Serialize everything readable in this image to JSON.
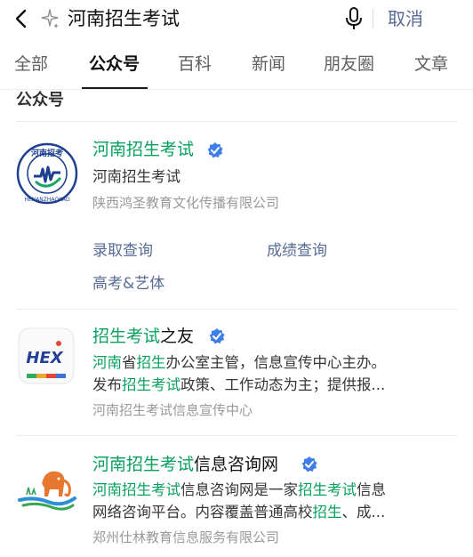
{
  "search": {
    "query": "河南招生考试",
    "cancel_label": "取消"
  },
  "tabs": [
    {
      "label": "全部",
      "active": false
    },
    {
      "label": "公众号",
      "active": true
    },
    {
      "label": "百科",
      "active": false
    },
    {
      "label": "新闻",
      "active": false
    },
    {
      "label": "朋友圈",
      "active": false
    },
    {
      "label": "文章",
      "active": false
    }
  ],
  "section_title": "公众号",
  "colors": {
    "highlight": "#07a05c",
    "link": "#576b95",
    "verified": "#3f7ee8"
  },
  "results": [
    {
      "name_highlight": "河南招生考试",
      "name_rest": "",
      "verified": true,
      "avatar_icon": "henan-zhaokao-logo",
      "avatar_text_top": "河南招考",
      "avatar_text_ring": "HENANZHAOKAO",
      "description": "河南招生考试",
      "org": "陕西鸿圣教育文化传播有限公司",
      "menu": [
        "录取查询",
        "成绩查询",
        "高考&艺体"
      ]
    },
    {
      "name_highlight": "招生考试",
      "name_rest": "之友",
      "verified": true,
      "avatar_icon": "hex-logo",
      "avatar_text": "HEX",
      "description_lines": [
        [
          {
            "t": "河南",
            "h": true
          },
          {
            "t": "省",
            "h": false
          },
          {
            "t": "招生",
            "h": true
          },
          {
            "t": "办公室主管，信息宣传中心主办。",
            "h": false
          }
        ],
        [
          {
            "t": "发布",
            "h": false
          },
          {
            "t": "招生考试",
            "h": true
          },
          {
            "t": "政策、工作动态为主；提供报...",
            "h": false
          }
        ]
      ],
      "org": "河南招生考试信息宣传中心"
    },
    {
      "name_highlight": "河南招生考试",
      "name_rest": "信息咨询网",
      "verified": true,
      "avatar_icon": "elephant-logo",
      "description_lines": [
        [
          {
            "t": "河南招生考试",
            "h": true
          },
          {
            "t": "信息咨询网是一家",
            "h": false
          },
          {
            "t": "招生考试",
            "h": true
          },
          {
            "t": "信息",
            "h": false
          }
        ],
        [
          {
            "t": "网络咨询平台。内容覆盖普通高校",
            "h": false
          },
          {
            "t": "招生",
            "h": true
          },
          {
            "t": "、成...",
            "h": false
          }
        ]
      ],
      "org": "郑州仕林教育信息服务有限公司"
    }
  ]
}
